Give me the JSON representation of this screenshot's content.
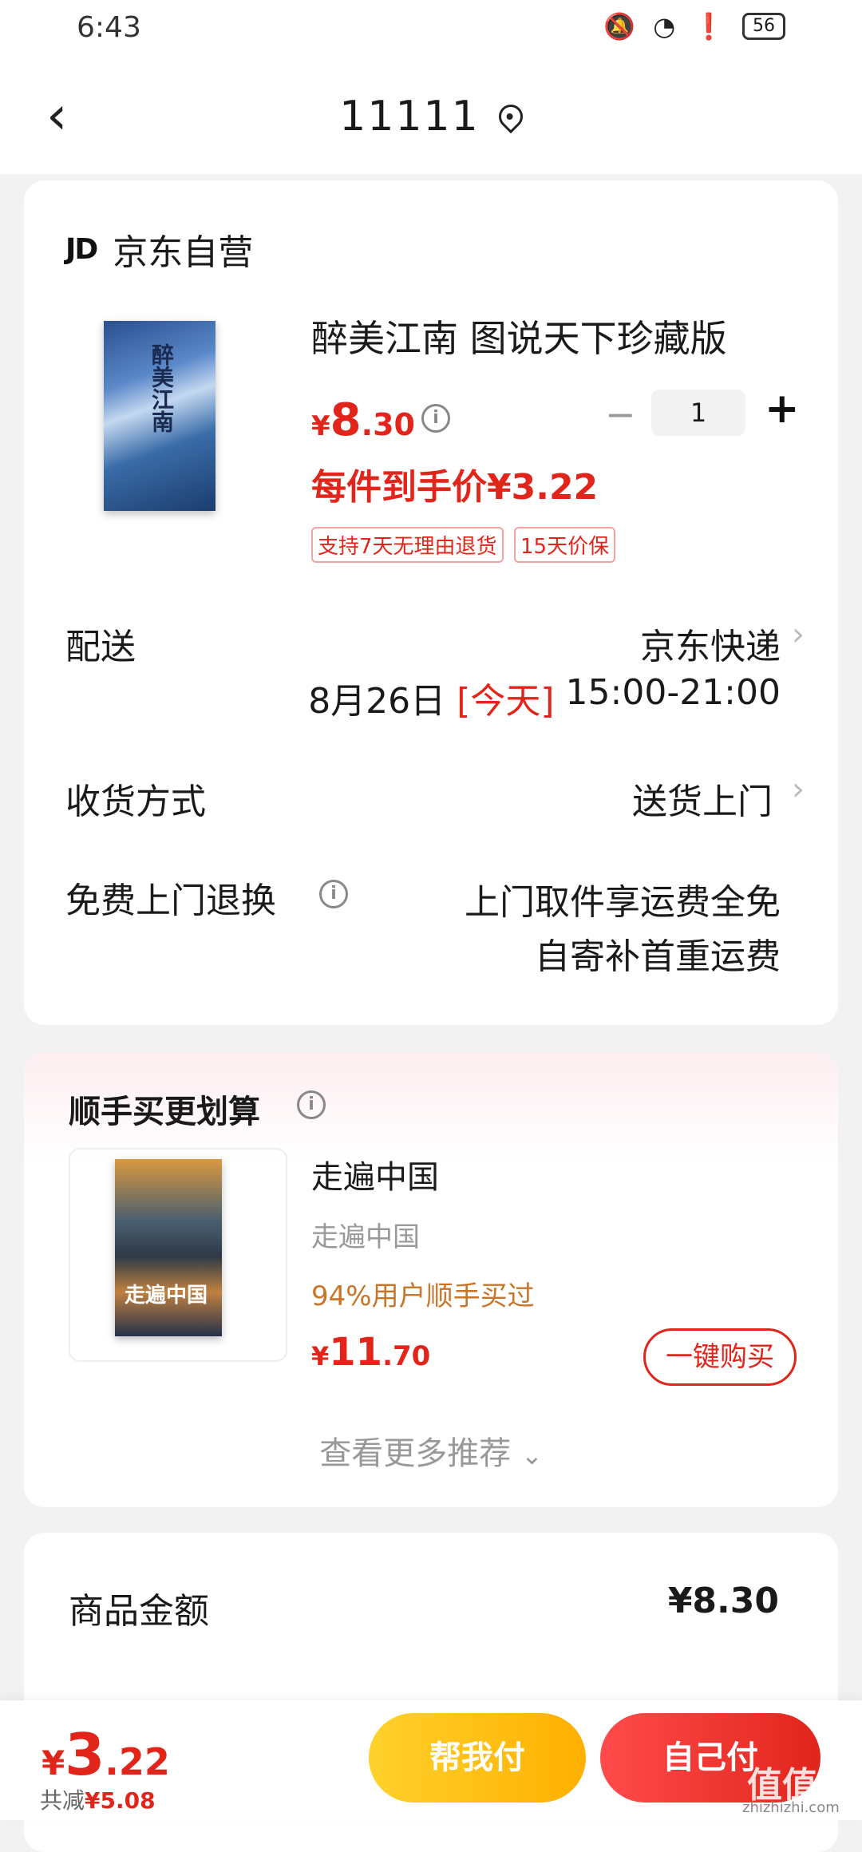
{
  "status_bar": {
    "time": "6:43",
    "battery": "56"
  },
  "header": {
    "title": "11111"
  },
  "shop": {
    "seller_logo": "JD",
    "seller_name": "京东自营",
    "product": {
      "name": "醉美江南 图说天下珍藏版",
      "cover_text": "醉美江南",
      "price_symbol": "¥",
      "price_int": "8",
      "price_dec": ".30",
      "quantity": "1",
      "promo_price": "每件到手价¥3.22",
      "tags": [
        "支持7天无理由退货",
        "15天价保"
      ]
    },
    "delivery": {
      "label": "配送",
      "carrier": "京东快递",
      "date": "8月26日",
      "today": "[今天]",
      "time_range": "15:00-21:00"
    },
    "receive": {
      "label": "收货方式",
      "value": "送货上门"
    },
    "return": {
      "label": "免费上门退换",
      "line1": "上门取件享运费全免",
      "line2": "自寄补首重运费"
    }
  },
  "recommend": {
    "title": "顺手买更划算",
    "item": {
      "name": "走遍中国",
      "subtitle": "走遍中国",
      "cover_text": "走遍中国",
      "stat": "94%用户顺手买过",
      "price_symbol": "¥",
      "price_int": "11",
      "price_dec": ".70",
      "buy_label": "一键购买"
    },
    "more_label": "查看更多推荐"
  },
  "summary": {
    "goods_label": "商品金额",
    "goods_value": "¥8.30"
  },
  "bottom": {
    "price_symbol": "¥",
    "total_int": "3",
    "total_dec": ".22",
    "saved_label": "共减",
    "saved_value": "¥5.08",
    "help_pay": "帮我付",
    "self_pay": "自己付",
    "watermark": "值值值",
    "watermark_sub": "zhizhizhi.com"
  },
  "colors": {
    "accent": "#e1251b",
    "gold": "#ffb000"
  }
}
